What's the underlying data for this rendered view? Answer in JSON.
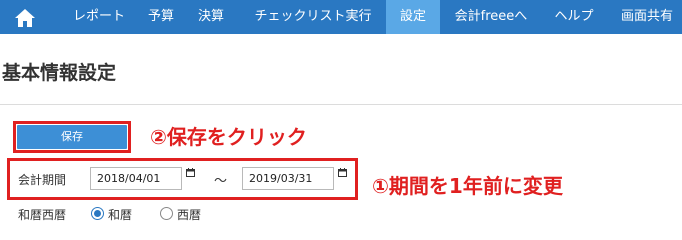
{
  "nav": {
    "items": [
      {
        "label": "レポート"
      },
      {
        "label": "予算"
      },
      {
        "label": "決算"
      },
      {
        "label": "チェックリスト実行"
      },
      {
        "label": "設定",
        "active": true
      },
      {
        "label": "会計freeeへ"
      },
      {
        "label": "ヘルプ"
      },
      {
        "label": "画面共有"
      }
    ]
  },
  "page": {
    "title": "基本情報設定"
  },
  "actions": {
    "save_label": "保存",
    "save_annotation": "②保存をクリック"
  },
  "period": {
    "label": "会計期間",
    "start": "2018/04/01",
    "separator": "～",
    "end": "2019/03/31",
    "annotation": "①期間を1年前に変更"
  },
  "calendar": {
    "label": "和暦西暦",
    "options": [
      {
        "label": "和暦",
        "selected": true
      },
      {
        "label": "西暦",
        "selected": false
      }
    ]
  },
  "colors": {
    "nav_bg": "#2a78c2",
    "nav_active": "#5aa8e6",
    "button_bg": "#3d8fd6",
    "annotation": "#e02020"
  },
  "icons": [
    "home-icon",
    "calendar-icon"
  ]
}
